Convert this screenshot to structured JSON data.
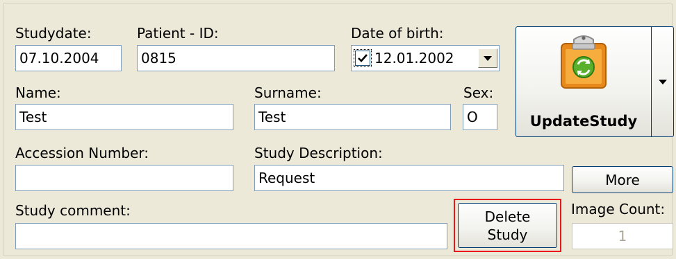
{
  "study": {
    "studydate_label": "Studydate:",
    "studydate": "07.10.2004",
    "patient_id_label": "Patient - ID:",
    "patient_id": "0815",
    "dob_label": "Date of birth:",
    "dob_checked": true,
    "dob": "12.01.2002",
    "name_label": "Name:",
    "name": "Test",
    "surname_label": "Surname:",
    "surname": "Test",
    "sex_label": "Sex:",
    "sex": "O",
    "accession_label": "Accession Number:",
    "accession": "",
    "description_label": "Study Description:",
    "description": "Request",
    "comment_label": "Study comment:",
    "comment": "",
    "image_count_label": "Image Count:",
    "image_count": "1"
  },
  "buttons": {
    "update_study": "UpdateStudy",
    "more": "More",
    "delete_line1": "Delete",
    "delete_line2": "Study"
  },
  "icons": {
    "update": "clipboard-refresh-icon",
    "dropdown": "chevron-down-icon",
    "checkbox": "checkmark-icon"
  },
  "colors": {
    "highlight_border": "#e8161b",
    "window_bg": "#ece9d8",
    "field_border": "#7f9db9"
  }
}
